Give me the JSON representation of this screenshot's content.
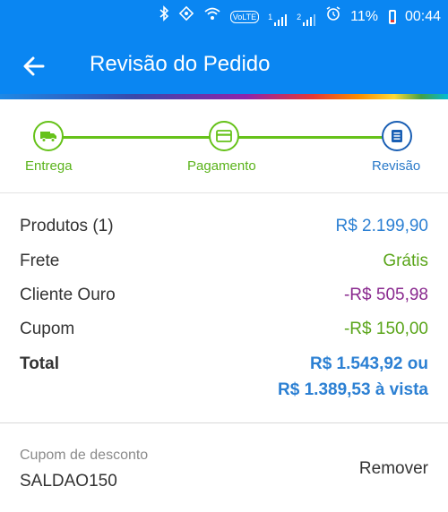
{
  "status_bar": {
    "battery": "11%",
    "time": "00:44",
    "network_badge": "VoLTE",
    "sim1": "1",
    "sim2": "2"
  },
  "app_bar": {
    "title": "Revisão do Pedido",
    "background_color": "#0a86f2"
  },
  "stepper": {
    "steps": [
      {
        "label": "Entrega",
        "icon": "truck-icon",
        "state": "done"
      },
      {
        "label": "Pagamento",
        "icon": "credit-card-icon",
        "state": "done"
      },
      {
        "label": "Revisão",
        "icon": "document-icon",
        "state": "current"
      }
    ],
    "line_color": "#66c21a"
  },
  "summary": {
    "products": {
      "label": "Produtos (1)",
      "value": "R$ 2.199,90"
    },
    "shipping": {
      "label": "Frete",
      "value": "Grátis"
    },
    "gold_client": {
      "label": "Cliente Ouro",
      "value": "-R$ 505,98"
    },
    "coupon": {
      "label": "Cupom",
      "value": "-R$ 150,00"
    },
    "total": {
      "label": "Total",
      "value_installments": "R$ 1.543,92 ou",
      "value_cash": "R$ 1.389,53 à vista"
    }
  },
  "coupon_section": {
    "caption": "Cupom de desconto",
    "code": "SALDAO150",
    "remove_label": "Remover"
  }
}
